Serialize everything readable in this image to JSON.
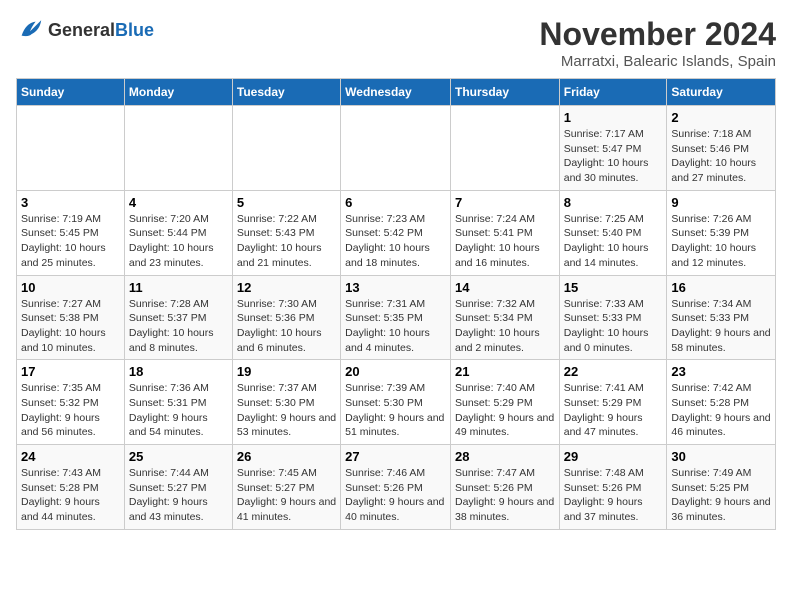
{
  "header": {
    "logo_general": "General",
    "logo_blue": "Blue",
    "month_title": "November 2024",
    "location": "Marratxi, Balearic Islands, Spain"
  },
  "days_of_week": [
    "Sunday",
    "Monday",
    "Tuesday",
    "Wednesday",
    "Thursday",
    "Friday",
    "Saturday"
  ],
  "weeks": [
    [
      {
        "day": "",
        "info": ""
      },
      {
        "day": "",
        "info": ""
      },
      {
        "day": "",
        "info": ""
      },
      {
        "day": "",
        "info": ""
      },
      {
        "day": "",
        "info": ""
      },
      {
        "day": "1",
        "info": "Sunrise: 7:17 AM\nSunset: 5:47 PM\nDaylight: 10 hours and 30 minutes."
      },
      {
        "day": "2",
        "info": "Sunrise: 7:18 AM\nSunset: 5:46 PM\nDaylight: 10 hours and 27 minutes."
      }
    ],
    [
      {
        "day": "3",
        "info": "Sunrise: 7:19 AM\nSunset: 5:45 PM\nDaylight: 10 hours and 25 minutes."
      },
      {
        "day": "4",
        "info": "Sunrise: 7:20 AM\nSunset: 5:44 PM\nDaylight: 10 hours and 23 minutes."
      },
      {
        "day": "5",
        "info": "Sunrise: 7:22 AM\nSunset: 5:43 PM\nDaylight: 10 hours and 21 minutes."
      },
      {
        "day": "6",
        "info": "Sunrise: 7:23 AM\nSunset: 5:42 PM\nDaylight: 10 hours and 18 minutes."
      },
      {
        "day": "7",
        "info": "Sunrise: 7:24 AM\nSunset: 5:41 PM\nDaylight: 10 hours and 16 minutes."
      },
      {
        "day": "8",
        "info": "Sunrise: 7:25 AM\nSunset: 5:40 PM\nDaylight: 10 hours and 14 minutes."
      },
      {
        "day": "9",
        "info": "Sunrise: 7:26 AM\nSunset: 5:39 PM\nDaylight: 10 hours and 12 minutes."
      }
    ],
    [
      {
        "day": "10",
        "info": "Sunrise: 7:27 AM\nSunset: 5:38 PM\nDaylight: 10 hours and 10 minutes."
      },
      {
        "day": "11",
        "info": "Sunrise: 7:28 AM\nSunset: 5:37 PM\nDaylight: 10 hours and 8 minutes."
      },
      {
        "day": "12",
        "info": "Sunrise: 7:30 AM\nSunset: 5:36 PM\nDaylight: 10 hours and 6 minutes."
      },
      {
        "day": "13",
        "info": "Sunrise: 7:31 AM\nSunset: 5:35 PM\nDaylight: 10 hours and 4 minutes."
      },
      {
        "day": "14",
        "info": "Sunrise: 7:32 AM\nSunset: 5:34 PM\nDaylight: 10 hours and 2 minutes."
      },
      {
        "day": "15",
        "info": "Sunrise: 7:33 AM\nSunset: 5:33 PM\nDaylight: 10 hours and 0 minutes."
      },
      {
        "day": "16",
        "info": "Sunrise: 7:34 AM\nSunset: 5:33 PM\nDaylight: 9 hours and 58 minutes."
      }
    ],
    [
      {
        "day": "17",
        "info": "Sunrise: 7:35 AM\nSunset: 5:32 PM\nDaylight: 9 hours and 56 minutes."
      },
      {
        "day": "18",
        "info": "Sunrise: 7:36 AM\nSunset: 5:31 PM\nDaylight: 9 hours and 54 minutes."
      },
      {
        "day": "19",
        "info": "Sunrise: 7:37 AM\nSunset: 5:30 PM\nDaylight: 9 hours and 53 minutes."
      },
      {
        "day": "20",
        "info": "Sunrise: 7:39 AM\nSunset: 5:30 PM\nDaylight: 9 hours and 51 minutes."
      },
      {
        "day": "21",
        "info": "Sunrise: 7:40 AM\nSunset: 5:29 PM\nDaylight: 9 hours and 49 minutes."
      },
      {
        "day": "22",
        "info": "Sunrise: 7:41 AM\nSunset: 5:29 PM\nDaylight: 9 hours and 47 minutes."
      },
      {
        "day": "23",
        "info": "Sunrise: 7:42 AM\nSunset: 5:28 PM\nDaylight: 9 hours and 46 minutes."
      }
    ],
    [
      {
        "day": "24",
        "info": "Sunrise: 7:43 AM\nSunset: 5:28 PM\nDaylight: 9 hours and 44 minutes."
      },
      {
        "day": "25",
        "info": "Sunrise: 7:44 AM\nSunset: 5:27 PM\nDaylight: 9 hours and 43 minutes."
      },
      {
        "day": "26",
        "info": "Sunrise: 7:45 AM\nSunset: 5:27 PM\nDaylight: 9 hours and 41 minutes."
      },
      {
        "day": "27",
        "info": "Sunrise: 7:46 AM\nSunset: 5:26 PM\nDaylight: 9 hours and 40 minutes."
      },
      {
        "day": "28",
        "info": "Sunrise: 7:47 AM\nSunset: 5:26 PM\nDaylight: 9 hours and 38 minutes."
      },
      {
        "day": "29",
        "info": "Sunrise: 7:48 AM\nSunset: 5:26 PM\nDaylight: 9 hours and 37 minutes."
      },
      {
        "day": "30",
        "info": "Sunrise: 7:49 AM\nSunset: 5:25 PM\nDaylight: 9 hours and 36 minutes."
      }
    ]
  ]
}
